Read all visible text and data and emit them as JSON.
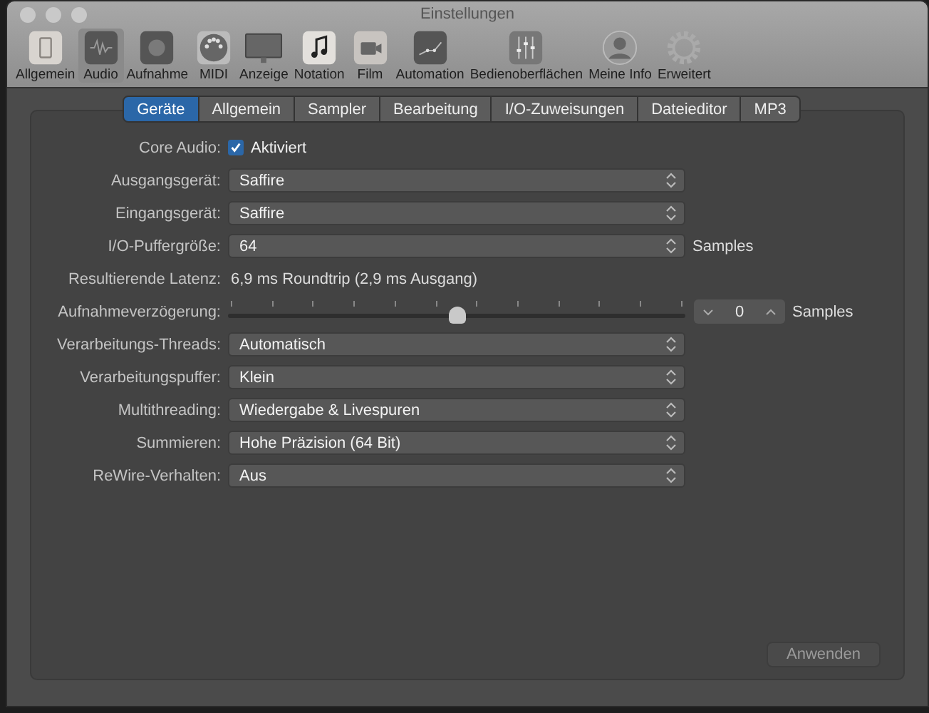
{
  "window": {
    "title": "Einstellungen"
  },
  "toolbar": [
    {
      "label": "Allgemein",
      "selected": false
    },
    {
      "label": "Audio",
      "selected": true
    },
    {
      "label": "Aufnahme",
      "selected": false
    },
    {
      "label": "MIDI",
      "selected": false
    },
    {
      "label": "Anzeige",
      "selected": false
    },
    {
      "label": "Notation",
      "selected": false
    },
    {
      "label": "Film",
      "selected": false
    },
    {
      "label": "Automation",
      "selected": false
    },
    {
      "label": "Bedienoberflächen",
      "selected": false
    },
    {
      "label": "Meine Info",
      "selected": false
    },
    {
      "label": "Erweitert",
      "selected": false
    }
  ],
  "tabs": [
    {
      "label": "Geräte",
      "selected": true
    },
    {
      "label": "Allgemein",
      "selected": false
    },
    {
      "label": "Sampler",
      "selected": false
    },
    {
      "label": "Bearbeitung",
      "selected": false
    },
    {
      "label": "I/O-Zuweisungen",
      "selected": false
    },
    {
      "label": "Dateieditor",
      "selected": false
    },
    {
      "label": "MP3",
      "selected": false
    }
  ],
  "rows": [
    {
      "kind": "checkbox",
      "label": "Core Audio:",
      "value": "Aktiviert",
      "checked": true
    },
    {
      "kind": "select",
      "label": "Ausgangsgerät:",
      "value": "Saffire"
    },
    {
      "kind": "select",
      "label": "Eingangsgerät:",
      "value": "Saffire"
    },
    {
      "kind": "select",
      "label": "I/O-Puffergröße:",
      "value": "64",
      "unit": "Samples"
    },
    {
      "kind": "text",
      "label": "Resultierende Latenz:",
      "value": "6,9 ms Roundtrip (2,9 ms Ausgang)"
    },
    {
      "kind": "slider",
      "label": "Aufnahmeverzögerung:",
      "level": 0.5,
      "value": "0",
      "unit": "Samples"
    },
    {
      "kind": "select",
      "label": "Verarbeitungs-Threads:",
      "value": "Automatisch"
    },
    {
      "kind": "select",
      "label": "Verarbeitungspuffer:",
      "value": "Klein"
    },
    {
      "kind": "select",
      "label": "Multithreading:",
      "value": "Wiedergabe & Livespuren"
    },
    {
      "kind": "select",
      "label": "Summieren:",
      "value": "Hohe Präzision (64 Bit)"
    },
    {
      "kind": "select",
      "label": "ReWire-Verhalten:",
      "value": "Aus"
    }
  ],
  "apply_button": {
    "label": "Anwenden",
    "disabled": true
  }
}
